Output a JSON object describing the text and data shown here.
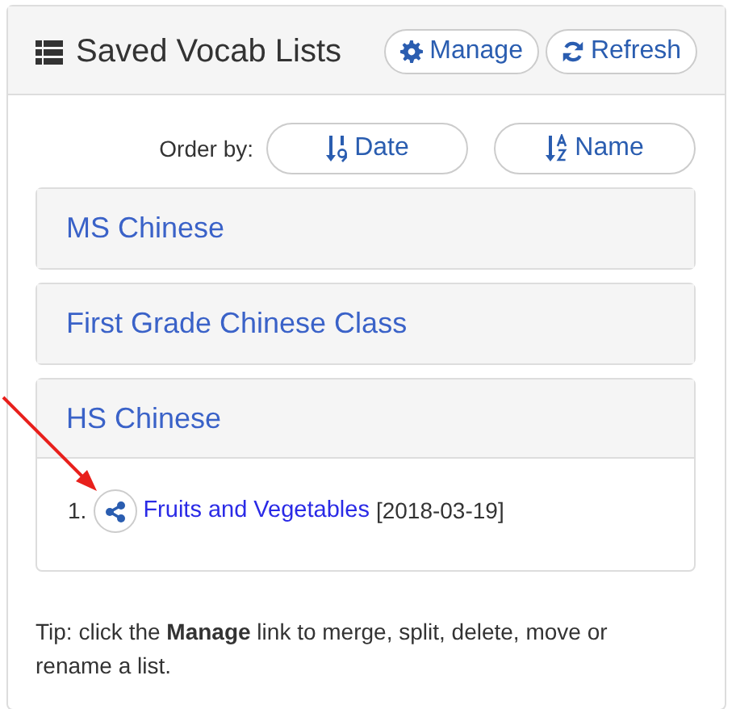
{
  "card": {
    "title": "Saved Vocab Lists",
    "header_buttons": [
      {
        "label": "Manage",
        "kind": "gear"
      },
      {
        "label": "Refresh",
        "kind": "refresh"
      }
    ],
    "order_by": {
      "label": "Order by:",
      "buttons": [
        {
          "label": "Date",
          "kind": "numeric"
        },
        {
          "label": "Name",
          "kind": "alpha"
        }
      ]
    },
    "groups": [
      {
        "name": "MS Chinese",
        "expanded": false
      },
      {
        "name": "First Grade Chinese Class",
        "expanded": false
      },
      {
        "name": "HS Chinese",
        "expanded": true,
        "lists": [
          {
            "number": "1.",
            "title": "Fruits and Vegetables",
            "date": "[2018-03-19]"
          }
        ]
      }
    ],
    "tip": "Tip: click the **Manage** link to merge, split, delete, move or rename a list."
  },
  "annotation": {
    "kind": "arrow",
    "color": "#e8201c"
  }
}
